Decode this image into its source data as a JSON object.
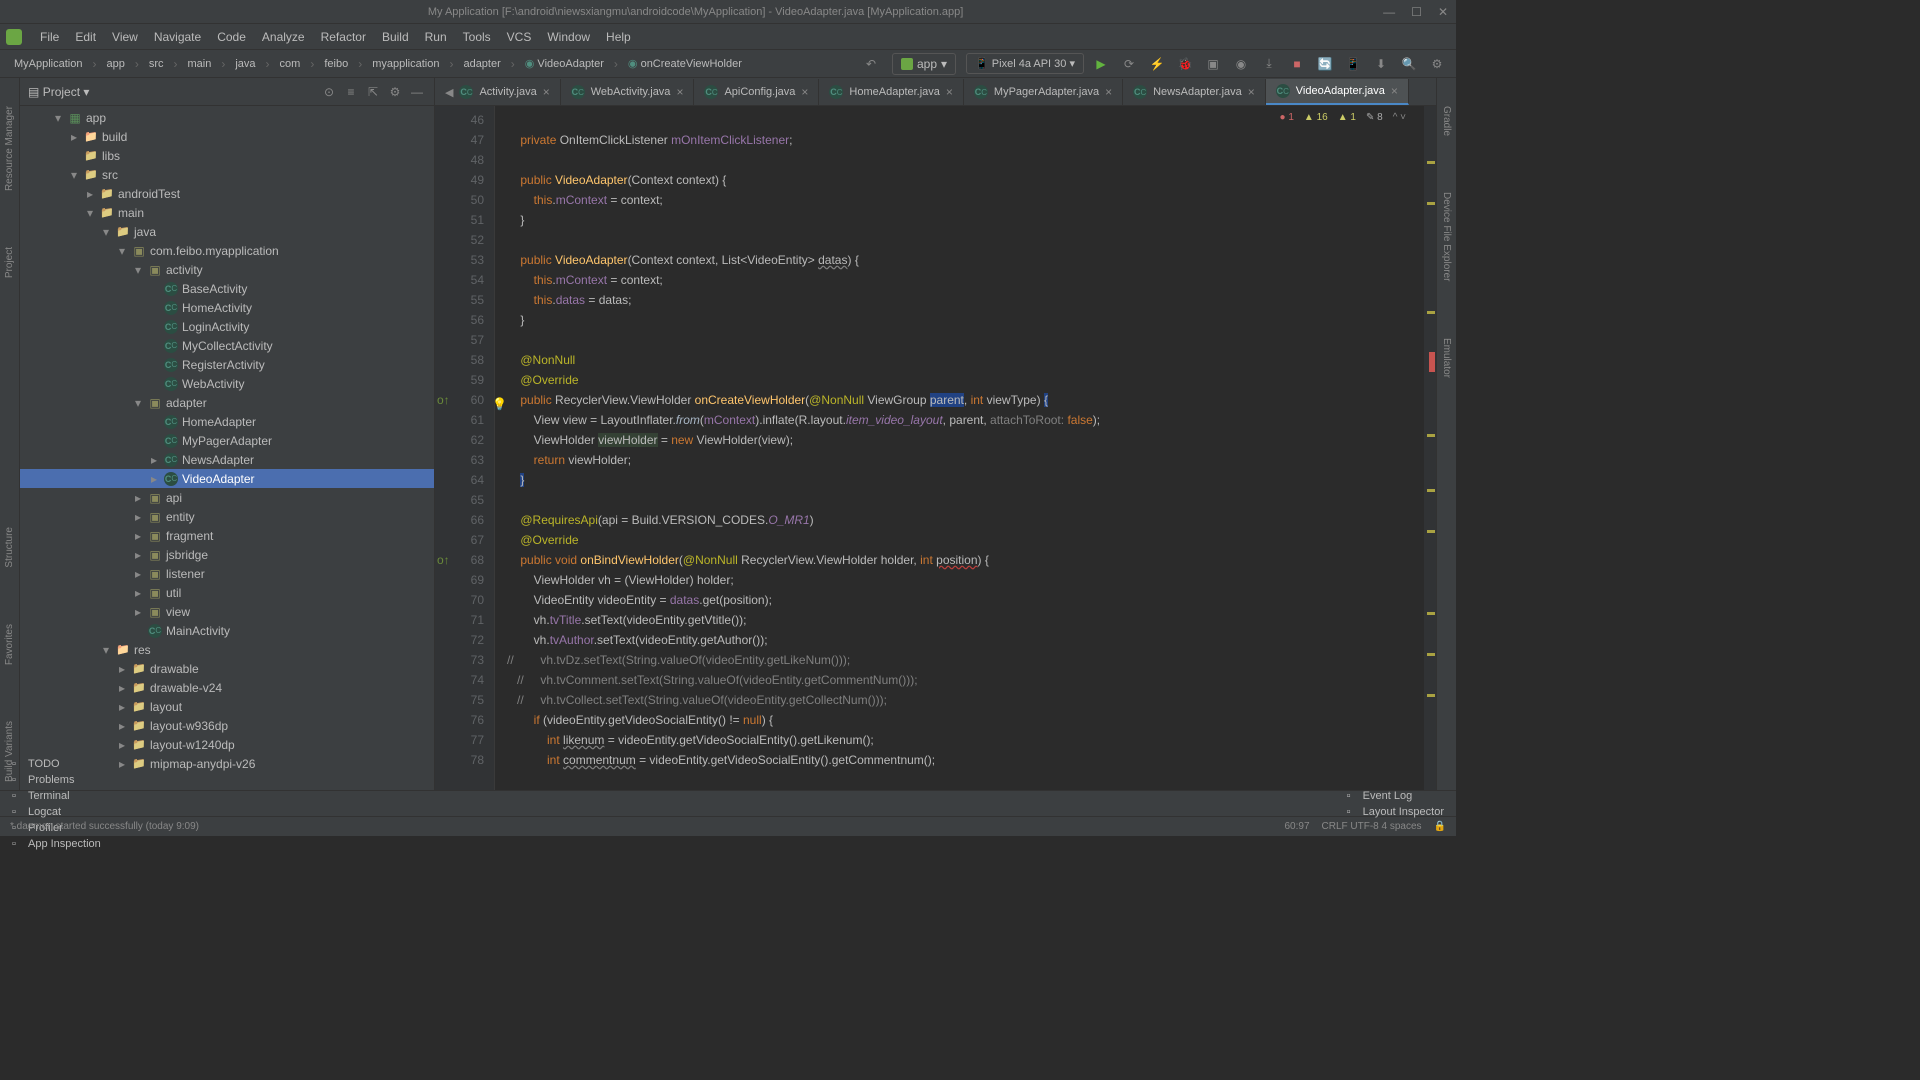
{
  "window": {
    "title": "My Application [F:\\android\\niewsxiangmu\\androidcode\\MyApplication] - VideoAdapter.java [MyApplication.app]"
  },
  "menu": [
    "File",
    "Edit",
    "View",
    "Navigate",
    "Code",
    "Analyze",
    "Refactor",
    "Build",
    "Run",
    "Tools",
    "VCS",
    "Window",
    "Help"
  ],
  "breadcrumbs": [
    "MyApplication",
    "app",
    "src",
    "main",
    "java",
    "com",
    "feibo",
    "myapplication",
    "adapter",
    "VideoAdapter",
    "onCreateViewHolder"
  ],
  "run_config": {
    "label": "app",
    "device": "Pixel 4a API 30"
  },
  "tabs": [
    {
      "label": "Activity.java",
      "active": false,
      "prefix": "◀"
    },
    {
      "label": "WebActivity.java",
      "active": false
    },
    {
      "label": "ApiConfig.java",
      "active": false
    },
    {
      "label": "HomeAdapter.java",
      "active": false
    },
    {
      "label": "MyPagerAdapter.java",
      "active": false
    },
    {
      "label": "NewsAdapter.java",
      "active": false
    },
    {
      "label": "VideoAdapter.java",
      "active": true
    }
  ],
  "project_panel": {
    "title": "Project"
  },
  "inspections": {
    "errors": "1",
    "warnings": "16",
    "weak": "1",
    "typos": "8"
  },
  "tree": [
    {
      "indent": 2,
      "arrow": "down",
      "icon": "module",
      "label": "app"
    },
    {
      "indent": 3,
      "arrow": "right",
      "icon": "folder-orange",
      "label": "build"
    },
    {
      "indent": 3,
      "arrow": "",
      "icon": "folder",
      "label": "libs"
    },
    {
      "indent": 3,
      "arrow": "down",
      "icon": "folder",
      "label": "src"
    },
    {
      "indent": 4,
      "arrow": "right",
      "icon": "folder",
      "label": "androidTest"
    },
    {
      "indent": 4,
      "arrow": "down",
      "icon": "folder",
      "label": "main"
    },
    {
      "indent": 5,
      "arrow": "down",
      "icon": "folder",
      "label": "java"
    },
    {
      "indent": 6,
      "arrow": "down",
      "icon": "package",
      "label": "com.feibo.myapplication"
    },
    {
      "indent": 7,
      "arrow": "down",
      "icon": "package",
      "label": "activity"
    },
    {
      "indent": 8,
      "arrow": "",
      "icon": "class",
      "label": "BaseActivity"
    },
    {
      "indent": 8,
      "arrow": "",
      "icon": "class",
      "label": "HomeActivity"
    },
    {
      "indent": 8,
      "arrow": "",
      "icon": "class",
      "label": "LoginActivity"
    },
    {
      "indent": 8,
      "arrow": "",
      "icon": "class",
      "label": "MyCollectActivity"
    },
    {
      "indent": 8,
      "arrow": "",
      "icon": "class",
      "label": "RegisterActivity"
    },
    {
      "indent": 8,
      "arrow": "",
      "icon": "class",
      "label": "WebActivity"
    },
    {
      "indent": 7,
      "arrow": "down",
      "icon": "package",
      "label": "adapter"
    },
    {
      "indent": 8,
      "arrow": "",
      "icon": "class",
      "label": "HomeAdapter"
    },
    {
      "indent": 8,
      "arrow": "",
      "icon": "class",
      "label": "MyPagerAdapter"
    },
    {
      "indent": 8,
      "arrow": "right",
      "icon": "class",
      "label": "NewsAdapter"
    },
    {
      "indent": 8,
      "arrow": "right",
      "icon": "class",
      "label": "VideoAdapter",
      "selected": true
    },
    {
      "indent": 7,
      "arrow": "right",
      "icon": "package",
      "label": "api"
    },
    {
      "indent": 7,
      "arrow": "right",
      "icon": "package",
      "label": "entity"
    },
    {
      "indent": 7,
      "arrow": "right",
      "icon": "package",
      "label": "fragment"
    },
    {
      "indent": 7,
      "arrow": "right",
      "icon": "package",
      "label": "jsbridge"
    },
    {
      "indent": 7,
      "arrow": "right",
      "icon": "package",
      "label": "listener"
    },
    {
      "indent": 7,
      "arrow": "right",
      "icon": "package",
      "label": "util"
    },
    {
      "indent": 7,
      "arrow": "right",
      "icon": "package",
      "label": "view"
    },
    {
      "indent": 7,
      "arrow": "",
      "icon": "class",
      "label": "MainActivity"
    },
    {
      "indent": 5,
      "arrow": "down",
      "icon": "folder-orange",
      "label": "res"
    },
    {
      "indent": 6,
      "arrow": "right",
      "icon": "folder",
      "label": "drawable"
    },
    {
      "indent": 6,
      "arrow": "right",
      "icon": "folder",
      "label": "drawable-v24"
    },
    {
      "indent": 6,
      "arrow": "right",
      "icon": "folder",
      "label": "layout"
    },
    {
      "indent": 6,
      "arrow": "right",
      "icon": "folder",
      "label": "layout-w936dp"
    },
    {
      "indent": 6,
      "arrow": "right",
      "icon": "folder",
      "label": "layout-w1240dp"
    },
    {
      "indent": 6,
      "arrow": "right",
      "icon": "folder",
      "label": "mipmap-anydpi-v26"
    }
  ],
  "code_lines": [
    {
      "n": 46,
      "html": ""
    },
    {
      "n": 47,
      "html": "    <span class='kw'>private</span> OnItemClickListener <span class='field'>mOnItemClickListener</span>;"
    },
    {
      "n": 48,
      "html": ""
    },
    {
      "n": 49,
      "html": "    <span class='kw'>public</span> <span class='method'>VideoAdapter</span>(Context context) {"
    },
    {
      "n": 50,
      "html": "        <span class='kw'>this</span>.<span class='field'>mContext</span> = context;"
    },
    {
      "n": 51,
      "html": "    }"
    },
    {
      "n": 52,
      "html": ""
    },
    {
      "n": 53,
      "html": "    <span class='kw'>public</span> <span class='method'>VideoAdapter</span>(Context context, List&lt;VideoEntity&gt; <span style='text-decoration:underline wavy #808080'>datas</span>) {"
    },
    {
      "n": 54,
      "html": "        <span class='kw'>this</span>.<span class='field'>mContext</span> = context;"
    },
    {
      "n": 55,
      "html": "        <span class='kw'>this</span>.<span class='field'>datas</span> = datas;"
    },
    {
      "n": 56,
      "html": "    }"
    },
    {
      "n": 57,
      "html": ""
    },
    {
      "n": 58,
      "html": "    <span class='anno'>@NonNull</span>"
    },
    {
      "n": 59,
      "html": "    <span class='anno'>@Override</span>"
    },
    {
      "n": 60,
      "html": "    <span class='kw'>public</span> RecyclerView.ViewHolder <span class='method'>onCreateViewHolder</span>(<span class='anno'>@NonNull</span> ViewGroup <span class='hl'>parent</span>, <span class='kw'>int</span> viewType) <span class='hl'>{</span>",
      "bulb": true,
      "ov": true
    },
    {
      "n": 61,
      "html": "        View view = LayoutInflater.<span class='static-m'>from</span>(<span class='field'>mContext</span>).inflate(R.layout.<span class='field' style='font-style:italic'>item_video_layout</span>, parent, <span class='comment'>attachToRoot:</span> <span class='kw'>false</span>);"
    },
    {
      "n": 62,
      "html": "        ViewHolder <span style='background:#344134'>viewHolder</span> = <span class='kw'>new</span> ViewHolder(view);"
    },
    {
      "n": 63,
      "html": "        <span class='kw'>return</span> viewHolder;"
    },
    {
      "n": 64,
      "html": "    <span class='hl'>}</span>"
    },
    {
      "n": 65,
      "html": ""
    },
    {
      "n": 66,
      "html": "    <span class='anno'>@RequiresApi</span>(api = Build.VERSION_CODES.<span class='field' style='font-style:italic'>O_MR1</span>)"
    },
    {
      "n": 67,
      "html": "    <span class='anno'>@Override</span>"
    },
    {
      "n": 68,
      "html": "    <span class='kw'>public void</span> <span class='method'>onBindViewHolder</span>(<span class='anno'>@NonNull</span> RecyclerView.ViewHolder holder, <span class='kw'>int</span> <span style='text-decoration:underline wavy #bc3f3c'>position</span>) {",
      "ov": true
    },
    {
      "n": 69,
      "html": "        ViewHolder vh = (ViewHolder) holder;"
    },
    {
      "n": 70,
      "html": "        VideoEntity videoEntity = <span class='field'>datas</span>.get(position);"
    },
    {
      "n": 71,
      "html": "        vh.<span class='field'>tvTitle</span>.setText(videoEntity.getVtitle());"
    },
    {
      "n": 72,
      "html": "        vh.<span class='field'>tvAuthor</span>.setText(videoEntity.getAuthor());"
    },
    {
      "n": 73,
      "html": "<span class='comment'>//        vh.tvDz.setText(String.valueOf(videoEntity.getLikeNum()));</span>"
    },
    {
      "n": 74,
      "html": "   <span class='comment'>//     vh.tvComment.setText(String.valueOf(videoEntity.getCommentNum()));</span>"
    },
    {
      "n": 75,
      "html": "   <span class='comment'>//     vh.tvCollect.setText(String.valueOf(videoEntity.getCollectNum()));</span>"
    },
    {
      "n": 76,
      "html": "        <span class='kw'>if</span> (videoEntity.getVideoSocialEntity() != <span class='kw'>null</span>) {"
    },
    {
      "n": 77,
      "html": "            <span class='kw'>int</span> <span style='text-decoration:underline wavy #808080'>likenum</span> = videoEntity.getVideoSocialEntity().getLikenum();"
    },
    {
      "n": 78,
      "html": "            <span class='kw'>int</span> <span style='text-decoration:underline wavy #808080'>commentnum</span> = videoEntity.getVideoSocialEntity().getCommentnum();"
    }
  ],
  "bottom_tabs": [
    "TODO",
    "Problems",
    "Terminal",
    "Logcat",
    "Profiler",
    "App Inspection"
  ],
  "bottom_right": [
    "Event Log",
    "Layout Inspector"
  ],
  "left_tool_buttons": [
    "Resource Manager"
  ],
  "left_tool_buttons2": [
    "Structure",
    "Favorites",
    "Build Variants"
  ],
  "right_tool_buttons": [
    "Gradle",
    "Device File Explorer",
    "Emulator"
  ],
  "status": {
    "msg": "* daemon started successfully (today 9:09)",
    "pos": "60:97",
    "enc": "CRLF  UTF-8  4 spaces"
  }
}
